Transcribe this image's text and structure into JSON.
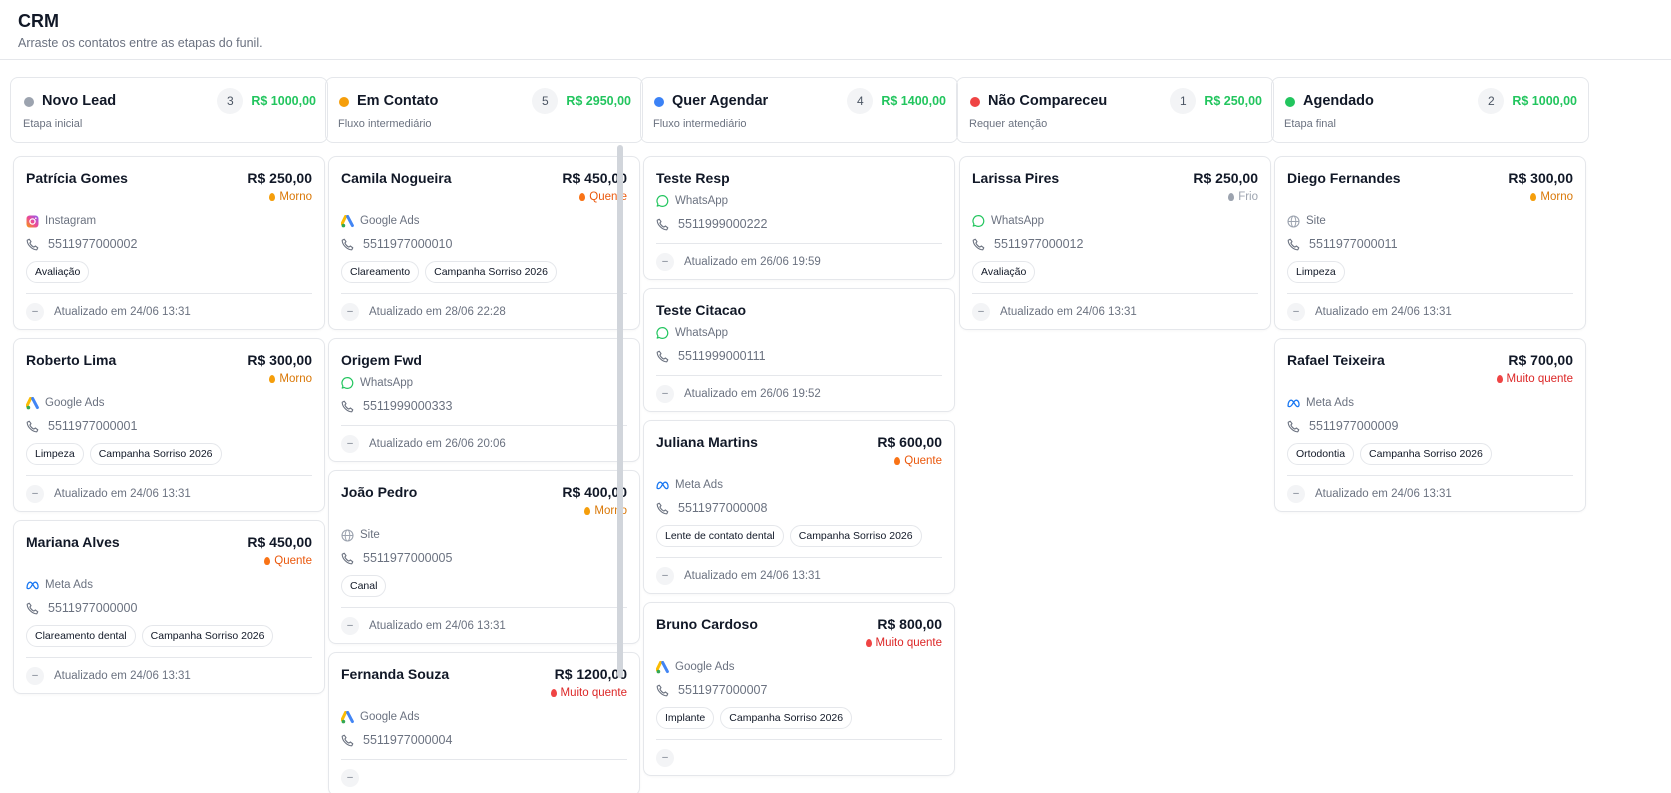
{
  "header": {
    "title": "CRM",
    "subtitle": "Arraste os contatos entre as etapas do funil."
  },
  "colors": {
    "total": "#22c55e",
    "morno": "#f59e0b",
    "quente": "#f97316",
    "muito_quente": "#ef4444",
    "frio": "#9ca3af"
  },
  "columns": [
    {
      "title": "Novo Lead",
      "subtitle": "Etapa inicial",
      "count": "3",
      "total": "R$ 1000,00",
      "dot_color": "#9ca3af",
      "cards": [
        {
          "name": "Patrícia Gomes",
          "value": "R$ 250,00",
          "temp": "Morno",
          "temp_class": "morno",
          "origin": "Instagram",
          "origin_icon": "instagram-icon",
          "phone": "5511977000002",
          "tags": [
            "Avaliação"
          ],
          "updated": "Atualizado em 24/06 13:31",
          "avatar": "–"
        },
        {
          "name": "Roberto Lima",
          "value": "R$ 300,00",
          "temp": "Morno",
          "temp_class": "morno",
          "origin": "Google Ads",
          "origin_icon": "google-ads-icon",
          "phone": "5511977000001",
          "tags": [
            "Limpeza",
            "Campanha Sorriso 2026"
          ],
          "updated": "Atualizado em 24/06 13:31",
          "avatar": "–"
        },
        {
          "name": "Mariana Alves",
          "value": "R$ 450,00",
          "temp": "Quente",
          "temp_class": "quente",
          "origin": "Meta Ads",
          "origin_icon": "meta-icon",
          "phone": "5511977000000",
          "tags": [
            "Clareamento dental",
            "Campanha Sorriso 2026"
          ],
          "updated": "Atualizado em 24/06 13:31",
          "avatar": "–"
        }
      ]
    },
    {
      "title": "Em Contato",
      "subtitle": "Fluxo intermediário",
      "count": "5",
      "total": "R$ 2950,00",
      "dot_color": "#f59e0b",
      "cards": [
        {
          "name": "Camila Nogueira",
          "value": "R$ 450,00",
          "temp": "Quente",
          "temp_class": "quente",
          "origin": "Google Ads",
          "origin_icon": "google-ads-icon",
          "phone": "5511977000010",
          "tags": [
            "Clareamento",
            "Campanha Sorriso 2026"
          ],
          "updated": "Atualizado em 28/06 22:28",
          "avatar": "–"
        },
        {
          "name": "Origem Fwd",
          "value": "",
          "temp": "",
          "temp_class": "",
          "origin": "WhatsApp",
          "origin_icon": "whatsapp-icon",
          "phone": "5511999000333",
          "tags": [],
          "updated": "Atualizado em 26/06 20:06",
          "avatar": "–"
        },
        {
          "name": "João Pedro",
          "value": "R$ 400,00",
          "temp": "Morno",
          "temp_class": "morno",
          "origin": "Site",
          "origin_icon": "globe-icon",
          "phone": "5511977000005",
          "tags": [
            "Canal"
          ],
          "updated": "Atualizado em 24/06 13:31",
          "avatar": "–"
        },
        {
          "name": "Fernanda Souza",
          "value": "R$ 1200,00",
          "temp": "Muito quente",
          "temp_class": "mquente",
          "origin": "Google Ads",
          "origin_icon": "google-ads-icon",
          "phone": "5511977000004",
          "tags": [],
          "updated": "",
          "avatar": "–"
        }
      ]
    },
    {
      "title": "Quer Agendar",
      "subtitle": "Fluxo intermediário",
      "count": "4",
      "total": "R$ 1400,00",
      "dot_color": "#3b82f6",
      "cards": [
        {
          "name": "Teste Resp",
          "value": "",
          "temp": "",
          "temp_class": "",
          "origin": "WhatsApp",
          "origin_icon": "whatsapp-icon",
          "phone": "5511999000222",
          "tags": [],
          "updated": "Atualizado em 26/06 19:59",
          "avatar": "–"
        },
        {
          "name": "Teste Citacao",
          "value": "",
          "temp": "",
          "temp_class": "",
          "origin": "WhatsApp",
          "origin_icon": "whatsapp-icon",
          "phone": "5511999000111",
          "tags": [],
          "updated": "Atualizado em 26/06 19:52",
          "avatar": "–"
        },
        {
          "name": "Juliana Martins",
          "value": "R$ 600,00",
          "temp": "Quente",
          "temp_class": "quente",
          "origin": "Meta Ads",
          "origin_icon": "meta-icon",
          "phone": "5511977000008",
          "tags": [
            "Lente de contato dental",
            "Campanha Sorriso 2026"
          ],
          "updated": "Atualizado em 24/06 13:31",
          "avatar": "–"
        },
        {
          "name": "Bruno Cardoso",
          "value": "R$ 800,00",
          "temp": "Muito quente",
          "temp_class": "mquente",
          "origin": "Google Ads",
          "origin_icon": "google-ads-icon",
          "phone": "5511977000007",
          "tags": [
            "Implante",
            "Campanha Sorriso 2026"
          ],
          "updated": "",
          "avatar": "–"
        }
      ]
    },
    {
      "title": "Não Compareceu",
      "subtitle": "Requer atenção",
      "count": "1",
      "total": "R$ 250,00",
      "dot_color": "#ef4444",
      "cards": [
        {
          "name": "Larissa Pires",
          "value": "R$ 250,00",
          "temp": "Frio",
          "temp_class": "frio",
          "origin": "WhatsApp",
          "origin_icon": "whatsapp-icon",
          "phone": "5511977000012",
          "tags": [
            "Avaliação"
          ],
          "updated": "Atualizado em 24/06 13:31",
          "avatar": "–"
        }
      ]
    },
    {
      "title": "Agendado",
      "subtitle": "Etapa final",
      "count": "2",
      "total": "R$ 1000,00",
      "dot_color": "#22c55e",
      "cards": [
        {
          "name": "Diego Fernandes",
          "value": "R$ 300,00",
          "temp": "Morno",
          "temp_class": "morno",
          "origin": "Site",
          "origin_icon": "globe-icon",
          "phone": "5511977000011",
          "tags": [
            "Limpeza"
          ],
          "updated": "Atualizado em 24/06 13:31",
          "avatar": "–"
        },
        {
          "name": "Rafael Teixeira",
          "value": "R$ 700,00",
          "temp": "Muito quente",
          "temp_class": "mquente",
          "origin": "Meta Ads",
          "origin_icon": "meta-icon",
          "phone": "5511977000009",
          "tags": [
            "Ortodontia",
            "Campanha Sorriso 2026"
          ],
          "updated": "Atualizado em 24/06 13:31",
          "avatar": "–"
        }
      ]
    }
  ]
}
